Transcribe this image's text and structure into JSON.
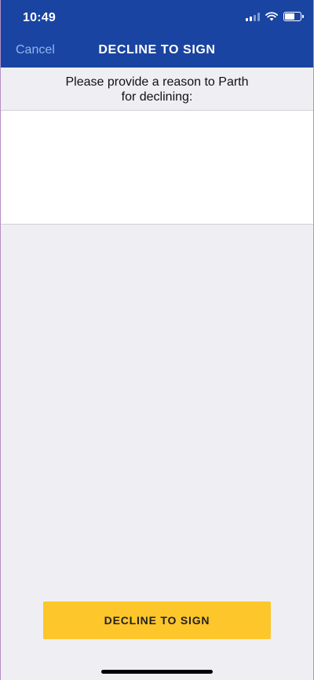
{
  "status_bar": {
    "time": "10:49",
    "icons": [
      "cellular-signal-icon",
      "wifi-icon",
      "battery-icon"
    ]
  },
  "nav": {
    "cancel_label": "Cancel",
    "title": "DECLINE TO SIGN"
  },
  "prompt": {
    "line1": "Please provide a reason to Parth",
    "line2": "for declining:"
  },
  "reason_input": {
    "value": "",
    "placeholder": ""
  },
  "actions": {
    "decline_label": "DECLINE TO SIGN"
  },
  "colors": {
    "header_bg": "#1a44a1",
    "cancel_link": "#8fb6f2",
    "button_bg": "#fdc62b",
    "page_bg": "#efeff3"
  }
}
